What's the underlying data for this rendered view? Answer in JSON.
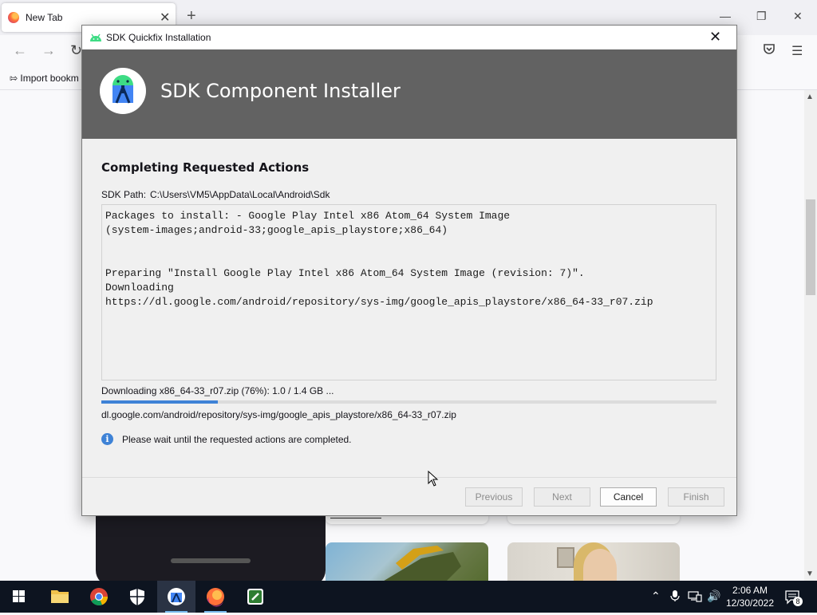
{
  "browser": {
    "tab_title": "New Tab",
    "tab_close": "✕",
    "new_tab": "+",
    "bookmark_label": "Import bookm"
  },
  "dialog": {
    "window_title": "SDK Quickfix Installation",
    "close_glyph": "✕",
    "banner_title": "SDK Component Installer",
    "heading": "Completing Requested Actions",
    "sdk_path_label": "SDK Path:",
    "sdk_path_value": "C:\\Users\\VM5\\AppData\\Local\\Android\\Sdk",
    "log_text": "Packages to install: - Google Play Intel x86 Atom_64 System Image\n(system-images;android-33;google_apis_playstore;x86_64)\n\n\nPreparing \"Install Google Play Intel x86 Atom_64 System Image (revision: 7)\".\nDownloading\nhttps://dl.google.com/android/repository/sys-img/google_apis_playstore/x86_64-33_r07.zip",
    "status_text": "Downloading x86_64-33_r07.zip (76%): 1.0 / 1.4 GB ...",
    "progress_fraction": 0.19,
    "url_text": "dl.google.com/android/repository/sys-img/google_apis_playstore/x86_64-33_r07.zip",
    "info_text": "Please wait until the requested actions are completed.",
    "buttons": {
      "previous": "Previous",
      "next": "Next",
      "cancel": "Cancel",
      "finish": "Finish"
    }
  },
  "taskbar": {
    "time": "2:06 AM",
    "date": "12/30/2022",
    "notification_count": "8"
  },
  "colors": {
    "banner": "#626262",
    "accent": "#3e82d6",
    "taskbar": "#0d1420"
  }
}
